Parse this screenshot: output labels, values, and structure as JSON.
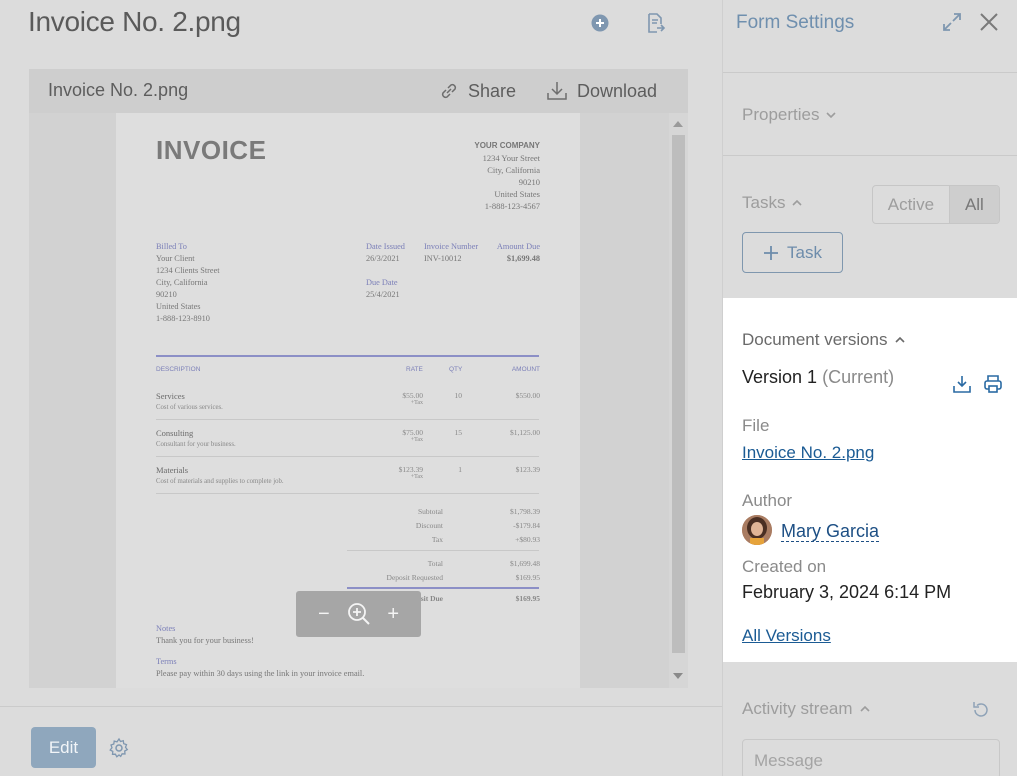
{
  "header": {
    "title": "Invoice No. 2.png"
  },
  "viewer": {
    "file_name": "Invoice No. 2.png",
    "share_label": "Share",
    "download_label": "Download"
  },
  "invoice": {
    "title": "INVOICE",
    "company": {
      "name": "YOUR COMPANY",
      "street": "1234 Your Street",
      "city": "City, California",
      "zip": "90210",
      "country": "United States",
      "phone": "1-888-123-4567"
    },
    "billed_to": {
      "label": "Billed To",
      "name": "Your Client",
      "street": "1234 Clients Street",
      "city": "City, California",
      "zip": "90210",
      "country": "United States",
      "phone": "1-888-123-8910"
    },
    "date_issued": {
      "label": "Date Issued",
      "value": "26/3/2021"
    },
    "invoice_number": {
      "label": "Invoice Number",
      "value": "INV-10012"
    },
    "amount_due": {
      "label": "Amount Due",
      "value": "$1,699.48"
    },
    "due_date": {
      "label": "Due Date",
      "value": "25/4/2021"
    },
    "columns": {
      "description": "DESCRIPTION",
      "rate": "RATE",
      "qty": "QTY",
      "amount": "AMOUNT"
    },
    "items": [
      {
        "name": "Services",
        "desc": "Cost of various services.",
        "rate": "$55.00",
        "tax": "+Tax",
        "qty": "10",
        "amount": "$550.00"
      },
      {
        "name": "Consulting",
        "desc": "Consultant for your business.",
        "rate": "$75.00",
        "tax": "+Tax",
        "qty": "15",
        "amount": "$1,125.00"
      },
      {
        "name": "Materials",
        "desc": "Cost of materials and supplies to complete job.",
        "rate": "$123.39",
        "tax": "+Tax",
        "qty": "1",
        "amount": "$123.39"
      }
    ],
    "totals": {
      "subtotal_label": "Subtotal",
      "subtotal": "$1,798.39",
      "discount_label": "Discount",
      "discount": "-$179.84",
      "tax_label": "Tax",
      "tax": "+$80.93",
      "total_label": "Total",
      "total": "$1,699.48",
      "deposit_label": "Deposit Requested",
      "deposit": "$169.95",
      "deposit_due_label": "Deposit Due",
      "deposit_due": "$169.95"
    },
    "notes": {
      "label": "Notes",
      "text": "Thank you for your business!"
    },
    "terms": {
      "label": "Terms",
      "text": "Please pay within 30 days using the link in your invoice email."
    }
  },
  "zoom": {
    "minus": "−",
    "plus": "+"
  },
  "footer": {
    "edit_label": "Edit"
  },
  "sidebar": {
    "title": "Form Settings",
    "properties_label": "Properties",
    "tasks_label": "Tasks",
    "tasks_filter": {
      "active": "Active",
      "all": "All",
      "selected": "All"
    },
    "task_button": "Task",
    "versions": {
      "title": "Document versions",
      "version_name": "Version 1",
      "version_status": "(Current)",
      "file_label": "File",
      "file_name": "Invoice No. 2.png",
      "author_label": "Author",
      "author_name": "Mary Garcia",
      "created_label": "Created on",
      "created_value": "February 3, 2024 6:14 PM",
      "all_versions": "All Versions"
    },
    "activity_label": "Activity stream",
    "message_placeholder": "Message"
  },
  "colors": {
    "accent": "#6f8fae",
    "link": "#1b5b94",
    "edit_button": "#8fa7bd",
    "invoice_blue": "#7b7fb8"
  },
  "icons": [
    "add-circle-icon",
    "document-send-icon",
    "link-icon",
    "download-icon",
    "zoom-in-icon",
    "gear-icon",
    "expand-icon",
    "close-icon",
    "chevron-down-icon",
    "chevron-up-icon",
    "plus-icon",
    "download-version-icon",
    "print-icon",
    "refresh-icon"
  ]
}
